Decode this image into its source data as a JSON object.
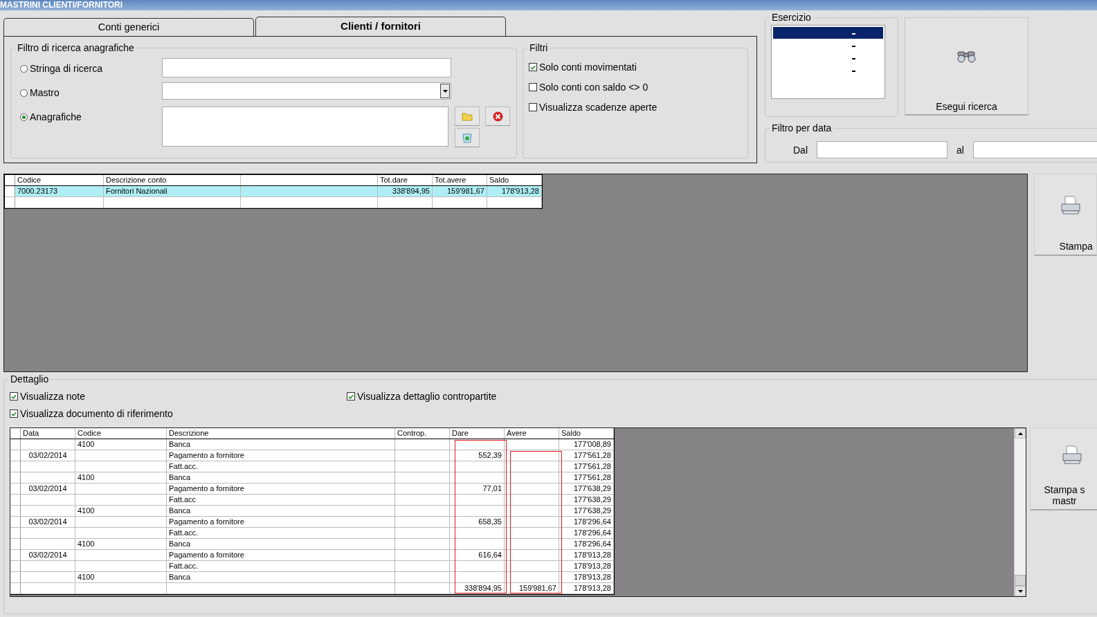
{
  "window": {
    "title": "MASTRINI CLIENTI/FORNITORI"
  },
  "tabs": [
    {
      "label": "Conti generici",
      "selected": false
    },
    {
      "label": "Clienti / fornitori",
      "selected": true
    }
  ],
  "search_filter": {
    "title": "Filtro di ricerca anagrafiche",
    "options": [
      {
        "label": "Stringa di ricerca",
        "selected": false,
        "kind": "text"
      },
      {
        "label": "Mastro",
        "selected": false,
        "kind": "combo"
      },
      {
        "label": "Anagrafiche",
        "selected": true,
        "kind": "list"
      }
    ]
  },
  "filters": {
    "title": "Filtri",
    "items": [
      {
        "label": "Solo conti movimentati",
        "checked": true
      },
      {
        "label": "Solo conti con saldo <> 0",
        "checked": false
      },
      {
        "label": "Visualizza scadenze aperte",
        "checked": false
      }
    ]
  },
  "esercizio": {
    "title": "Esercizio",
    "items": [
      {
        "selected": true
      },
      {
        "selected": false
      },
      {
        "selected": false
      },
      {
        "selected": false
      }
    ]
  },
  "search_button": {
    "label": "Esegui ricerca"
  },
  "date_filter": {
    "title": "Filtro per data",
    "from_label": "Dal",
    "to_label": "al"
  },
  "accounts_table": {
    "columns": [
      {
        "label": "Codice"
      },
      {
        "label": "Descrizione conto"
      },
      {},
      {
        "label": "Tot.dare"
      },
      {
        "label": "Tot.avere"
      },
      {
        "label": "Saldo"
      }
    ],
    "rows": [
      {
        "selected": true,
        "cells": [
          "7000.23173",
          "Fornitori Nazionali",
          null,
          "338'894,95",
          "159'981,67",
          "178'913,28"
        ]
      }
    ]
  },
  "print_button": {
    "label": "Stampa"
  },
  "detail": {
    "title": "Dettaglio",
    "options": [
      {
        "label": "Visualizza note",
        "checked": true
      },
      {
        "label": "Visualizza dettaglio contropartite",
        "checked": true
      },
      {
        "label": "Visualizza documento di riferimento",
        "checked": true
      }
    ],
    "columns": [
      {
        "label": "Data"
      },
      {
        "label": "Codice"
      },
      {
        "label": "Descrizione"
      },
      {
        "label": "Controp."
      },
      {
        "label": "Dare"
      },
      {
        "label": "Avere"
      },
      {
        "label": "Saldo"
      }
    ],
    "rows": [
      [
        null,
        "4100",
        "Banca",
        null,
        null,
        null,
        "177'008,89"
      ],
      [
        "03/02/2014",
        null,
        "Pagamento a fornitore",
        null,
        "552,39",
        null,
        "177'561,28"
      ],
      [
        null,
        null,
        "Fatt.acc.",
        null,
        null,
        null,
        "177'561,28"
      ],
      [
        null,
        "4100",
        "Banca",
        null,
        null,
        null,
        "177'561,28"
      ],
      [
        "03/02/2014",
        null,
        "Pagamento a fornitore",
        null,
        "77,01",
        null,
        "177'638,29"
      ],
      [
        null,
        null,
        "Fatt.acc",
        null,
        null,
        null,
        "177'638,29"
      ],
      [
        null,
        "4100",
        "Banca",
        null,
        null,
        null,
        "177'638,29"
      ],
      [
        "03/02/2014",
        null,
        "Pagamento a fornitore",
        null,
        "658,35",
        null,
        "178'296,64"
      ],
      [
        null,
        null,
        "Fatt.acc.",
        null,
        null,
        null,
        "178'296,64"
      ],
      [
        null,
        "4100",
        "Banca",
        null,
        null,
        null,
        "178'296,64"
      ],
      [
        "03/02/2014",
        null,
        "Pagamento a fornitore",
        null,
        "616,64",
        null,
        "178'913,28"
      ],
      [
        null,
        null,
        "Fatt.acc.",
        null,
        null,
        null,
        "178'913,28"
      ],
      [
        null,
        "4100",
        "Banca",
        null,
        null,
        null,
        "178'913,28"
      ],
      [
        null,
        null,
        null,
        null,
        "338'894,95",
        "159'981,67",
        "178'913,28"
      ]
    ]
  },
  "print_ledger_button": {
    "lines": [
      "Stampa s",
      "mastr"
    ]
  }
}
